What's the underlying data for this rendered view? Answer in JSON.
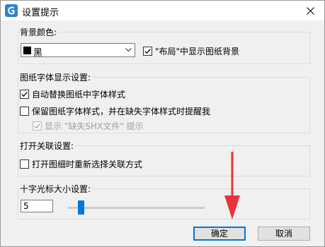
{
  "window": {
    "title": "设置提示",
    "close_glyph": "✕"
  },
  "background": {
    "group_label": "背景颜色:",
    "color_value": "黑",
    "swatch_color": "#000000",
    "layout_checkbox_label": "\"布局\"中显示图纸背景",
    "layout_checked": true
  },
  "font": {
    "group_label": "图纸字体显示设置:",
    "auto_replace_label": "自动替换图纸中字体样式",
    "auto_replace_checked": true,
    "keep_style_label": "保留图纸字体样式，并在缺失字体样式时提醒我",
    "keep_style_checked": false,
    "show_missing_label": "显示 \"缺失SHX文件\" 提示",
    "show_missing_checked": true,
    "show_missing_disabled": true
  },
  "association": {
    "group_label": "打开关联设置:",
    "reselect_label": "打开图细时重新选择关联方式",
    "reselect_checked": false
  },
  "crosshair": {
    "group_label": "十字光标大小设置:",
    "size_value": "5",
    "slider_fraction": 0.05
  },
  "buttons": {
    "ok_label": "确定",
    "cancel_label": "取消"
  },
  "colors": {
    "accent": "#0078d7",
    "annotation_arrow": "#e8333a"
  }
}
